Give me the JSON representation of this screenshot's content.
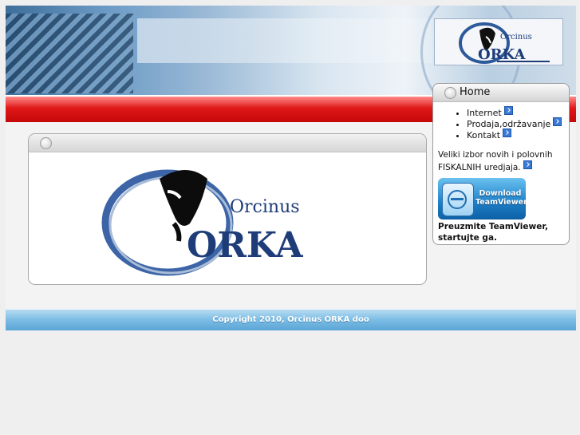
{
  "brand": {
    "line1": "Orcinus",
    "line2": "ORKA"
  },
  "sidebar": {
    "title": "Home",
    "menu": [
      {
        "label": "Internet"
      },
      {
        "label": "Prodaja,održavanje"
      },
      {
        "label": "Kontakt"
      }
    ],
    "promo_text": "Veliki izbor novih i polovnih FISKALNIH uredjaja.",
    "teamviewer_button": {
      "line1": "Download",
      "line2": "TeamViewer"
    },
    "teamviewer_caption": "Preuzmite TeamViewer, startujte ga."
  },
  "footer": {
    "copyright": "Copyright 2010, Orcinus ORKA doo"
  },
  "colors": {
    "nav_red": "#e01818",
    "footer_blue": "#7bbce4",
    "brand_navy": "#1e3c78"
  }
}
